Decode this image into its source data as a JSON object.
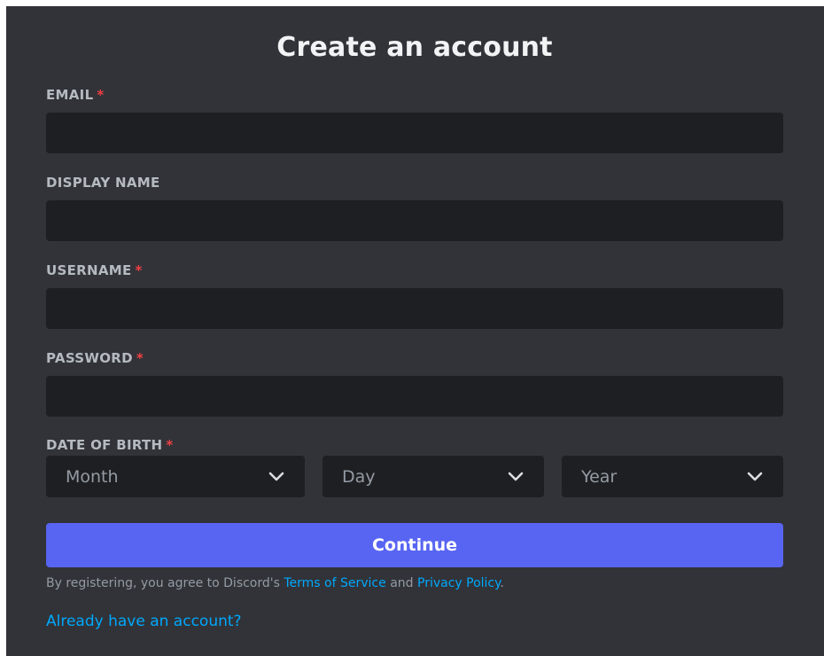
{
  "form": {
    "title": "Create an account",
    "required_marker": "*",
    "fields": {
      "email": {
        "label": "EMAIL",
        "value": "",
        "required": true
      },
      "display_name": {
        "label": "DISPLAY NAME",
        "value": "",
        "required": false
      },
      "username": {
        "label": "USERNAME",
        "value": "",
        "required": true
      },
      "password": {
        "label": "PASSWORD",
        "value": "",
        "required": true
      }
    },
    "dob": {
      "label": "DATE OF BIRTH",
      "required": true,
      "month_placeholder": "Month",
      "day_placeholder": "Day",
      "year_placeholder": "Year"
    },
    "continue_label": "Continue",
    "legal": {
      "prefix": "By registering, you agree to Discord's",
      "tos_link": "Terms of Service",
      "connector": "and",
      "privacy_link": "Privacy Policy",
      "suffix": "."
    },
    "login_link": "Already have an account?"
  },
  "colors": {
    "panel_bg": "#313338",
    "input_bg": "#1e1f22",
    "accent": "#5865f2",
    "link": "#00a8fc",
    "required": "#f23f43"
  },
  "icons": {
    "select_arrow": "chevron-down-icon"
  }
}
